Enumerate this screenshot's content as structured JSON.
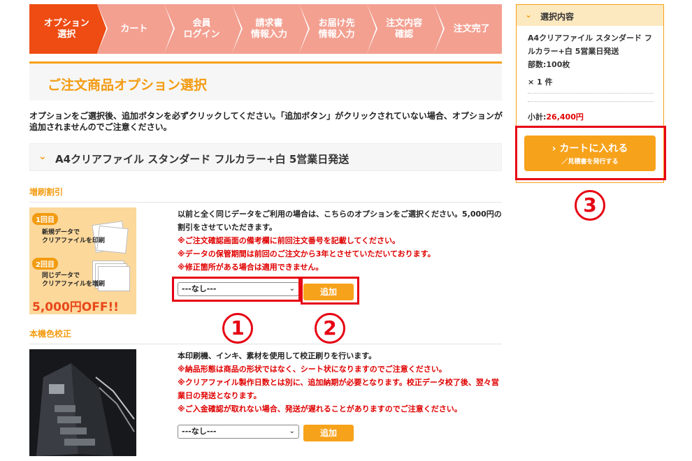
{
  "steps": [
    {
      "label": "オプション\n選択",
      "active": true
    },
    {
      "label": "カート",
      "active": false
    },
    {
      "label": "会員\nログイン",
      "active": false
    },
    {
      "label": "請求書\n情報入力",
      "active": false
    },
    {
      "label": "お届け先\n情報入力",
      "active": false
    },
    {
      "label": "注文内容\n確認",
      "active": false
    },
    {
      "label": "注文完了",
      "active": false
    }
  ],
  "page_title": "ご注文商品オプション選択",
  "notice": "オプションをご選択後、追加ボタンを必ずクリックしてください。「追加ボタン」がクリックされていない場合、オプションが追加されませんのでご注意ください。",
  "product": {
    "title": "A4クリアファイル スタンダード フルカラー+白 5営業日発送"
  },
  "option1": {
    "title": "増刷割引",
    "thumb": {
      "badge1": "1回目",
      "text1": "新規データで\nクリアファイルを印刷",
      "badge2": "2回目",
      "text2": "同じデータで\nクリアファイルを増刷",
      "off": "5,000円OFF!!"
    },
    "desc": "以前と全く同じデータをご利用の場合は、こちらのオプションをご選択ください。5,000円の割引をさせていただきます。",
    "notes": [
      "※ご注文確認画面の備考欄に前回注文番号を記載してください。",
      "※データの保管期間は前回のご注文から3年とさせていただいております。",
      "※修正箇所がある場合は適用できません。"
    ],
    "select_value": "---なし---",
    "add_label": "追加"
  },
  "option2": {
    "title": "本機色校正",
    "desc": "本印刷機、インキ、素材を使用して校正刷りを行います。",
    "notes": [
      "※納品形態は商品の形状ではなく、シート状になりますのでご注意ください。",
      "※クリアファイル製作日数とは別に、追加納期が必要となります。校正データ校了後、翌々営業日の発送となります。",
      "※ご入金確認が取れない場合、発送が遅れることがありますのでご注意ください。"
    ],
    "select_value": "---なし---",
    "add_label": "追加"
  },
  "sidebar": {
    "title": "選択内容",
    "item_name": "A4クリアファイル スタンダード フルカラー+白 5営業日発送",
    "quantity": "部数:100枚",
    "count": "× 1 件",
    "subtotal_label": "小計:",
    "subtotal_value": "26,400円",
    "cart_button": "› カートに入れる",
    "cart_sub": "／見積書を発行する"
  },
  "annotations": {
    "n1": "1",
    "n2": "2",
    "n3": "3"
  },
  "colors": {
    "accent": "#f39c12",
    "step_active": "#ee4c13",
    "step_inactive": "#f3a091",
    "highlight_red": "#e60012",
    "button_orange": "#f7a21b"
  }
}
